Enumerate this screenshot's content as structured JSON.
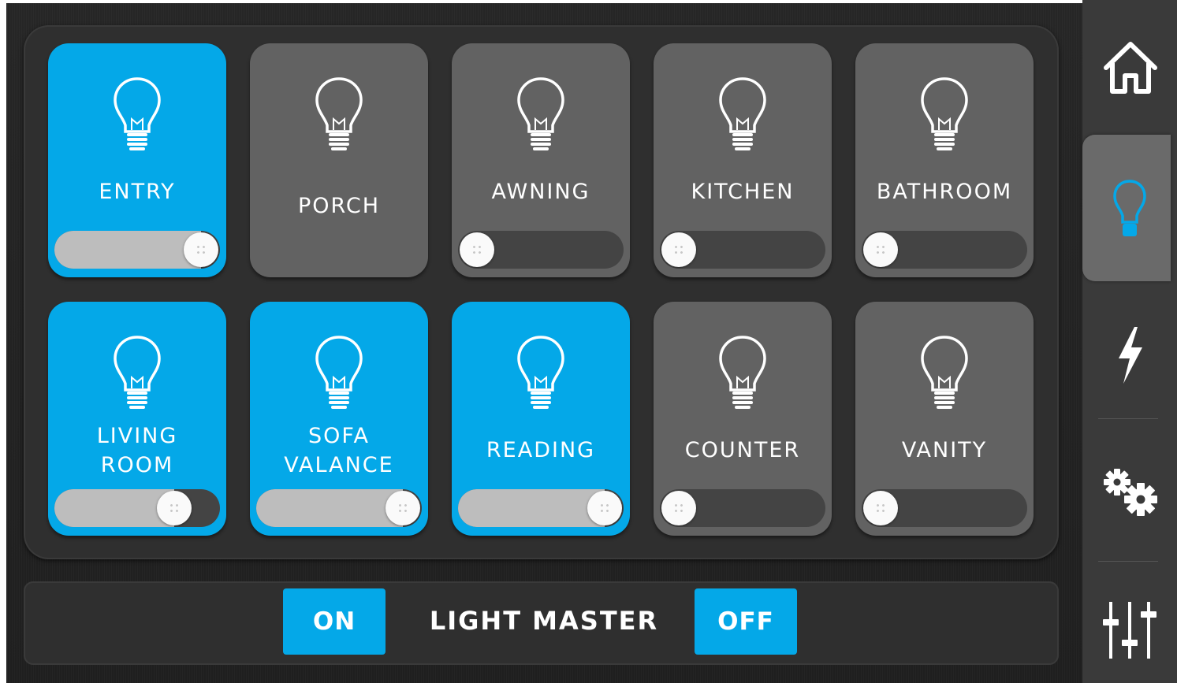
{
  "colors": {
    "active": "#04a8e8",
    "inactive": "#626262",
    "track": "#444444",
    "track_fill": "#bdbdbd"
  },
  "lights": [
    {
      "label": "ENTRY",
      "on": true,
      "has_slider": true,
      "level": 1.0
    },
    {
      "label": "PORCH",
      "on": false,
      "has_slider": false
    },
    {
      "label": "AWNING",
      "on": false,
      "has_slider": true,
      "level": 0.0
    },
    {
      "label": "KITCHEN",
      "on": false,
      "has_slider": true,
      "level": 0.0
    },
    {
      "label": "BATHROOM",
      "on": false,
      "has_slider": true,
      "level": 0.0
    },
    {
      "label": "LIVING\nROOM",
      "on": true,
      "has_slider": true,
      "level": 0.79
    },
    {
      "label": "SOFA\nVALANCE",
      "on": true,
      "has_slider": true,
      "level": 1.0
    },
    {
      "label": "READING",
      "on": true,
      "has_slider": true,
      "level": 1.0
    },
    {
      "label": "COUNTER",
      "on": false,
      "has_slider": true,
      "level": 0.0
    },
    {
      "label": "VANITY",
      "on": false,
      "has_slider": true,
      "level": 0.0
    }
  ],
  "master": {
    "on_label": "ON",
    "label": "LIGHT MASTER",
    "off_label": "OFF"
  },
  "nav": [
    {
      "icon": "home-icon",
      "active": false
    },
    {
      "icon": "lightbulb-icon",
      "active": true
    },
    {
      "icon": "lightning-icon",
      "active": false
    },
    {
      "icon": "gears-icon",
      "active": false
    },
    {
      "icon": "sliders-icon",
      "active": false
    }
  ]
}
